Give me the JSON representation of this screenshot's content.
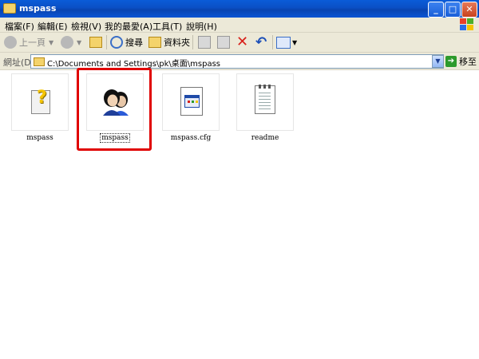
{
  "window": {
    "title": "mspass",
    "minimize": "_",
    "maximize": "□",
    "close": "✕"
  },
  "menu": [
    "檔案(F)",
    "編輯(E)",
    "檢視(V)",
    "我的最愛(A)",
    "工具(T)",
    "說明(H)"
  ],
  "toolbar": {
    "back_label": "上一頁",
    "search_label": "搜尋",
    "folders_label": "資料夾"
  },
  "address": {
    "label": "網址(D)",
    "path": "C:\\Documents and Settings\\pk\\桌面\\mspass",
    "go_label": "移至"
  },
  "files": [
    {
      "name": "mspass",
      "icon": "help-file-icon",
      "selected": false
    },
    {
      "name": "mspass",
      "icon": "people-app-icon",
      "selected": true
    },
    {
      "name": "mspass.cfg",
      "icon": "config-file-icon",
      "selected": false
    },
    {
      "name": "readme",
      "icon": "text-document-icon",
      "selected": false
    }
  ],
  "colors": {
    "titlebar": "#0a4fc4",
    "highlight": "#e00000",
    "chrome": "#ece9d8"
  }
}
